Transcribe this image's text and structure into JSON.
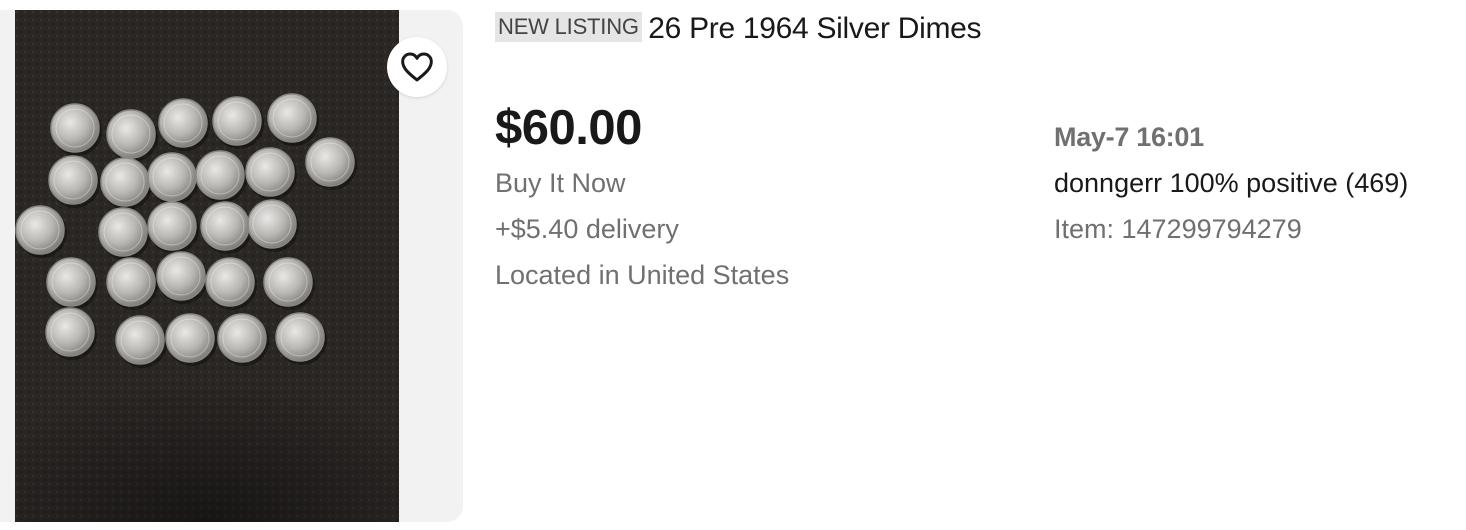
{
  "listing": {
    "badge": "NEW LISTING",
    "title": "26 Pre 1964 Silver Dimes",
    "price": "$60.00",
    "buy_format": "Buy It Now",
    "shipping": "+$5.40 delivery",
    "location": "Located in United States",
    "end_date": "May-7 16:01",
    "seller": {
      "name": "donngerr",
      "feedback": "100% positive (469)"
    },
    "item_number": "Item: 147299794279"
  },
  "image": {
    "subject": "26 silver dimes arranged in rows on dark leather",
    "coin_count": 26
  },
  "icons": {
    "watchlist": "heart-icon"
  },
  "colors": {
    "title_text": "#191919",
    "secondary_text": "#707070",
    "badge_bg": "#e5e5e5",
    "panel_bg": "#f2f2f2"
  }
}
